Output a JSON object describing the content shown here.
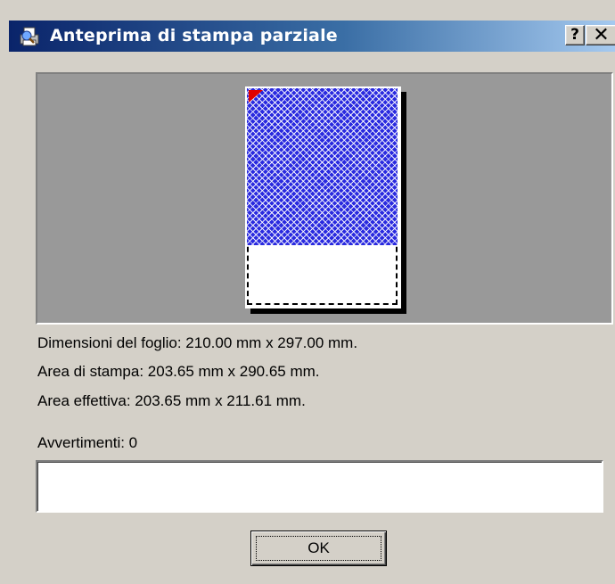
{
  "window": {
    "title": "Anteprima di stampa parziale",
    "help_label": "?",
    "close_label": "✕",
    "icon": "printer-preview-icon"
  },
  "preview": {
    "page_color": "#ffffff",
    "effective_area_color": "#2a2adf",
    "marker_color": "#e00000"
  },
  "info": {
    "sheet_dimensions": "Dimensioni del foglio: 210.00 mm x 297.00 mm.",
    "print_area": "Area di stampa: 203.65 mm x 290.65 mm.",
    "effective_area": "Area effettiva:  203.65 mm x 211.61 mm.",
    "warnings_label": "Avvertimenti: 0"
  },
  "warnings": {
    "value": ""
  },
  "buttons": {
    "ok_label": "OK"
  }
}
